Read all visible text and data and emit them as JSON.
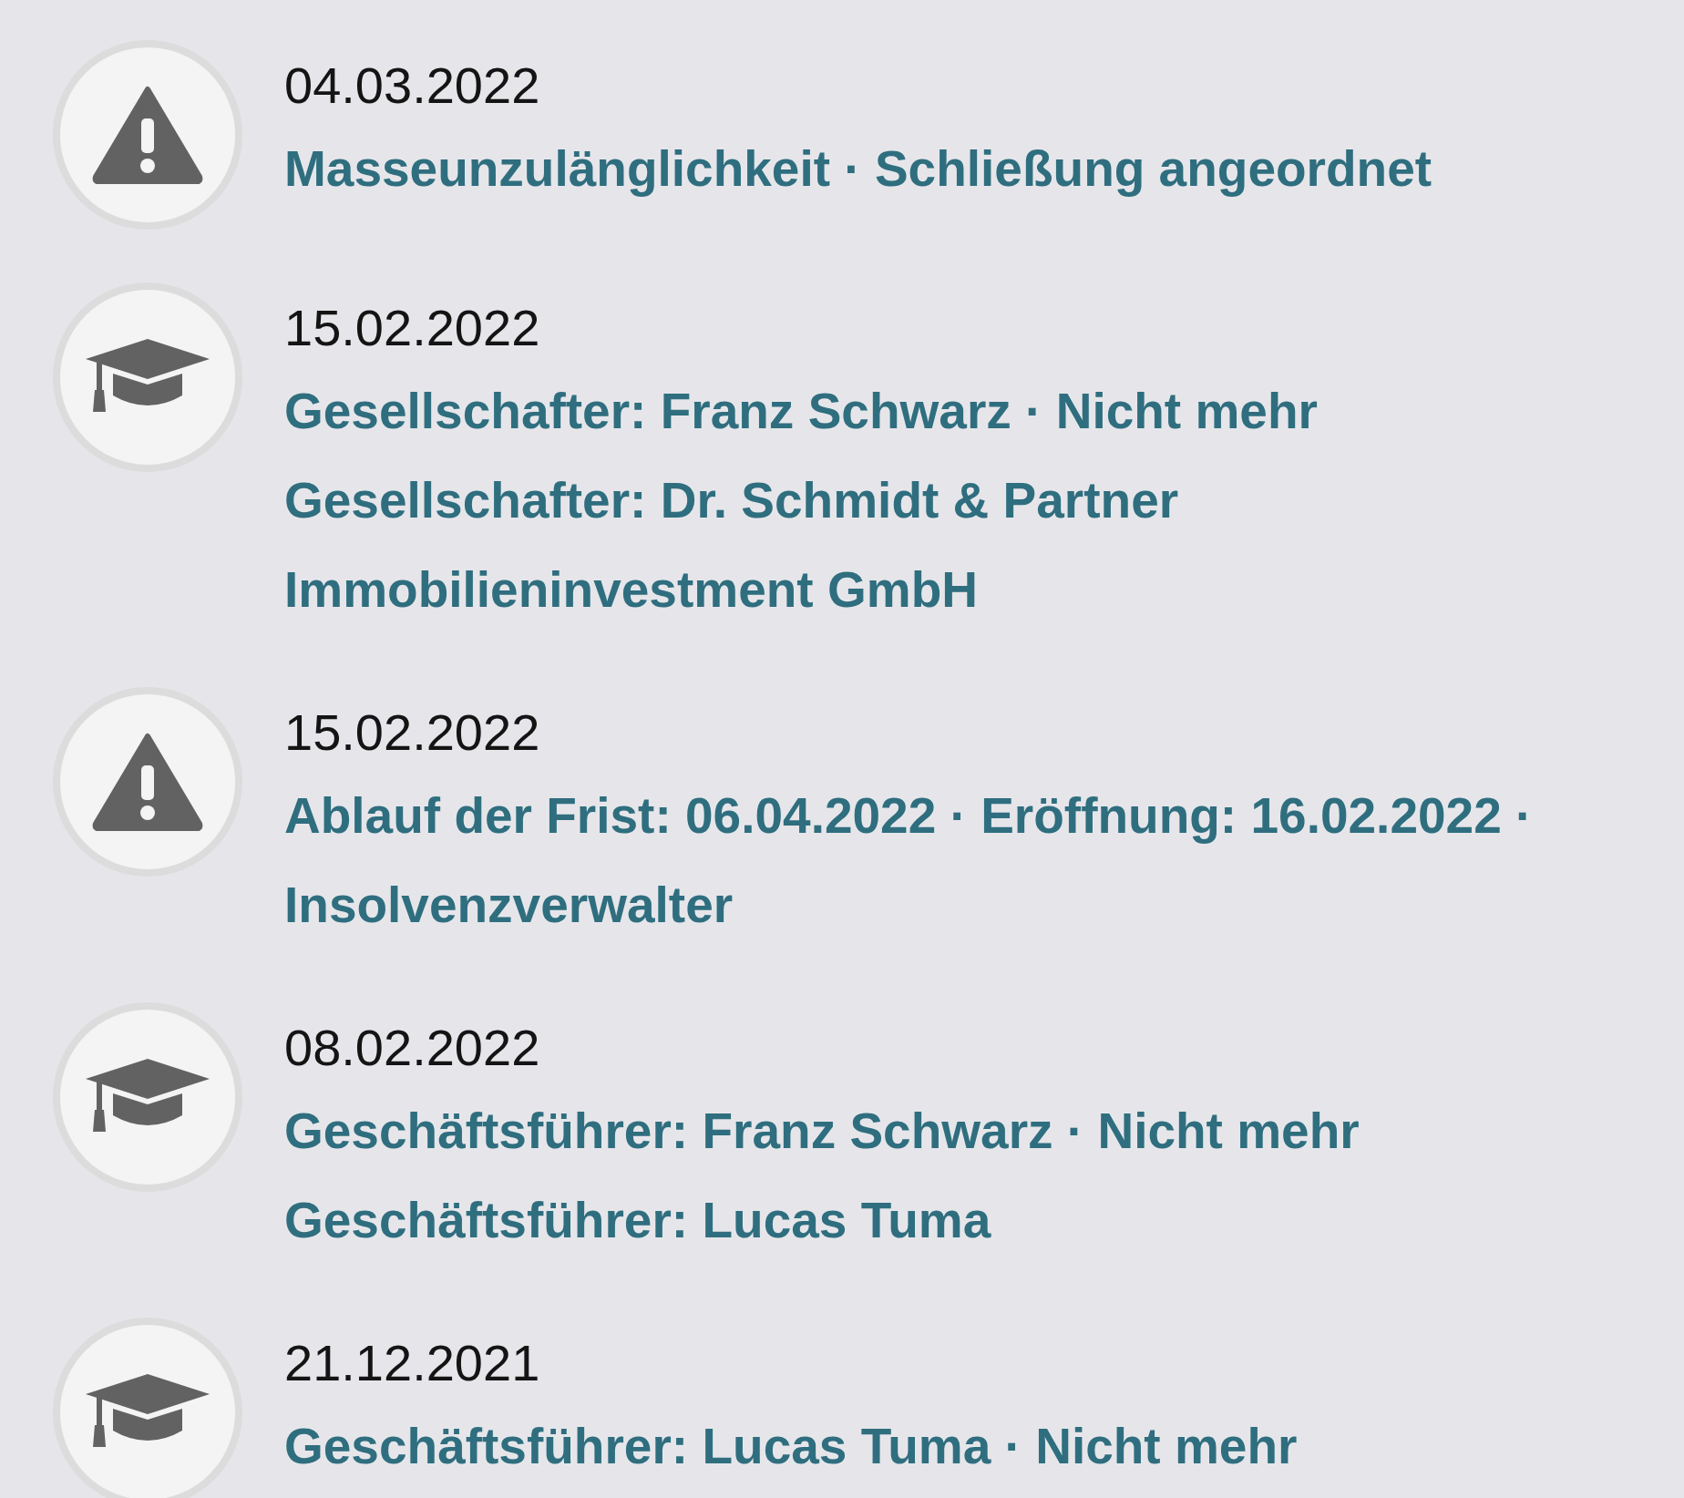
{
  "timeline": [
    {
      "kind": "warning",
      "date": "04.03.2022",
      "lines": [
        "Masseunzulänglichkeit · Schließung angeordnet"
      ]
    },
    {
      "kind": "education",
      "date": "15.02.2022",
      "lines": [
        "Gesellschafter: Franz Schwarz · Nicht mehr",
        "Gesellschafter: Dr. Schmidt & Partner Immobilieninvestment GmbH"
      ]
    },
    {
      "kind": "warning",
      "date": "15.02.2022",
      "lines": [
        "Ablauf der Frist: 06.04.2022 · Eröffnung: 16.02.2022 · Insolvenzverwalter"
      ]
    },
    {
      "kind": "education",
      "date": "08.02.2022",
      "lines": [
        "Geschäftsführer: Franz Schwarz · Nicht mehr",
        "Geschäftsführer: Lucas Tuma"
      ]
    },
    {
      "kind": "education",
      "date": "21.12.2021",
      "lines": [
        "Geschäftsführer: Lucas Tuma · Nicht mehr"
      ]
    }
  ]
}
